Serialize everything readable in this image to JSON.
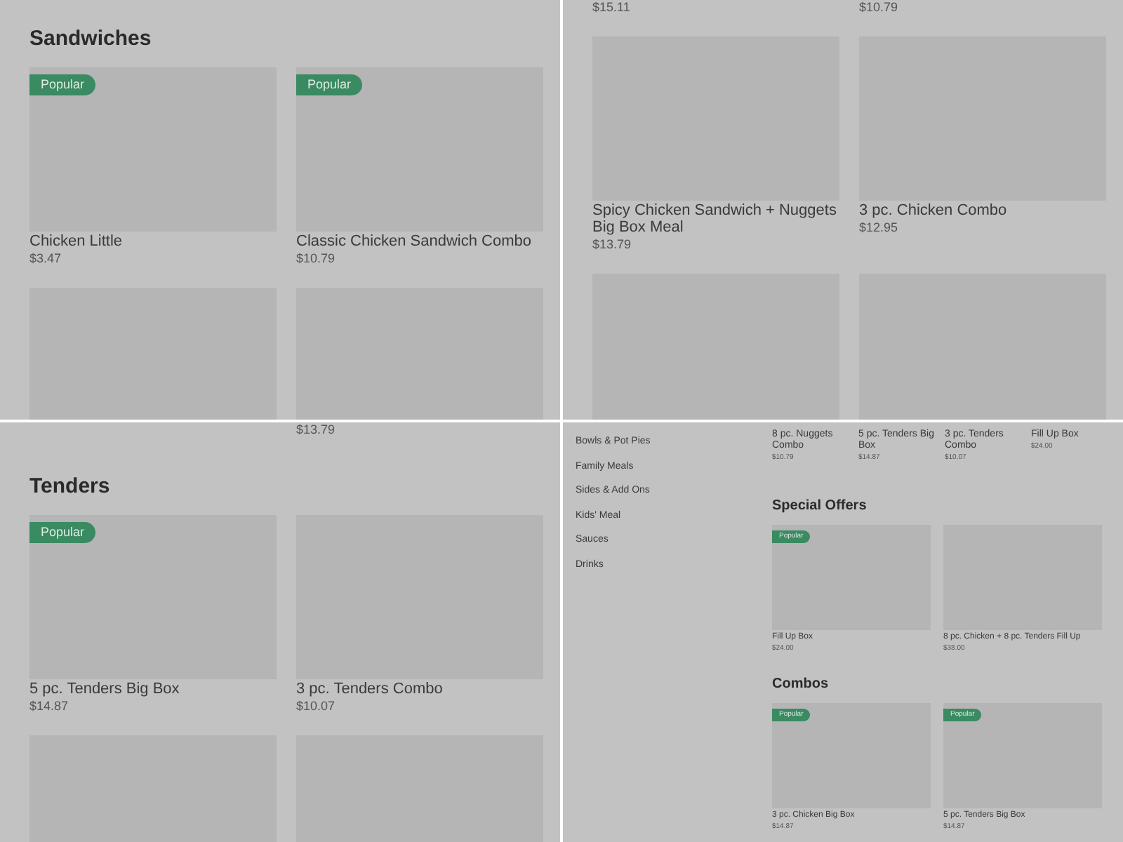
{
  "panels": [
    {
      "kind": "full",
      "blocks": [
        {
          "kind": "heading",
          "text": "Sandwiches"
        },
        {
          "kind": "cards",
          "cards": [
            {
              "name": "Chicken Little",
              "price": "$3.47",
              "popular": true,
              "badge": "Popular"
            },
            {
              "name": "Classic Chicken Sandwich Combo",
              "price": "$10.79",
              "popular": true,
              "badge": "Popular"
            }
          ]
        },
        {
          "kind": "cards",
          "cards": [
            {
              "popular": false
            },
            {
              "popular": false
            }
          ]
        }
      ]
    },
    {
      "kind": "full",
      "blocks": [
        {
          "kind": "prices",
          "cells": [
            {
              "kind": "price",
              "text": "$15.11"
            },
            {
              "kind": "price",
              "text": "$10.79"
            }
          ]
        },
        {
          "kind": "cards",
          "cards": [
            {
              "name": "Spicy Chicken Sandwich + Nuggets Big Box Meal",
              "price": "$13.79",
              "popular": false
            },
            {
              "name": "3 pc. Chicken Combo",
              "price": "$12.95",
              "popular": false
            }
          ]
        },
        {
          "kind": "cards",
          "cards": [
            {
              "popular": false
            },
            {
              "popular": false
            }
          ]
        }
      ]
    },
    {
      "kind": "full",
      "blocks": [
        {
          "kind": "prices",
          "cells": [
            {
              "kind": "blank"
            },
            {
              "kind": "price",
              "text": "$13.79"
            }
          ]
        },
        {
          "kind": "heading",
          "text": "Tenders"
        },
        {
          "kind": "cards",
          "cards": [
            {
              "name": "5 pc. Tenders Big Box",
              "price": "$14.87",
              "popular": true,
              "badge": "Popular"
            },
            {
              "name": "3 pc. Tenders Combo",
              "price": "$10.07",
              "popular": false
            }
          ]
        },
        {
          "kind": "cards",
          "cards": [
            {
              "popular": false
            },
            {
              "popular": false
            }
          ]
        }
      ]
    },
    {
      "kind": "compact",
      "sidebar": {
        "items": [
          "Bowls & Pot Pies",
          "Family Meals",
          "Sides & Add Ons",
          "Kids' Meal",
          "Sauces",
          "Drinks"
        ]
      },
      "blocks": [
        {
          "kind": "mini_cards",
          "cards": [
            {
              "name": "8 pc. Nuggets Combo",
              "price": "$10.79"
            },
            {
              "name": "5 pc. Tenders Big Box",
              "price": "$14.87"
            },
            {
              "name": "3 pc. Tenders Combo",
              "price": "$10.07"
            },
            {
              "name": "Fill Up Box",
              "price": "$24.00"
            }
          ]
        },
        {
          "kind": "heading",
          "text": "Special Offers"
        },
        {
          "kind": "cards",
          "cards": [
            {
              "name": "Fill Up Box",
              "price": "$24.00",
              "popular": true,
              "badge": "Popular"
            },
            {
              "name": "8 pc. Chicken + 8 pc. Tenders Fill Up",
              "price": "$38.00",
              "popular": false
            }
          ]
        },
        {
          "kind": "heading",
          "text": "Combos"
        },
        {
          "kind": "cards",
          "cards": [
            {
              "name": "3 pc. Chicken Big Box",
              "price": "$14.87",
              "popular": true,
              "badge": "Popular"
            },
            {
              "name": "5 pc. Tenders Big Box",
              "price": "$14.87",
              "popular": true,
              "badge": "Popular"
            }
          ]
        }
      ]
    }
  ]
}
